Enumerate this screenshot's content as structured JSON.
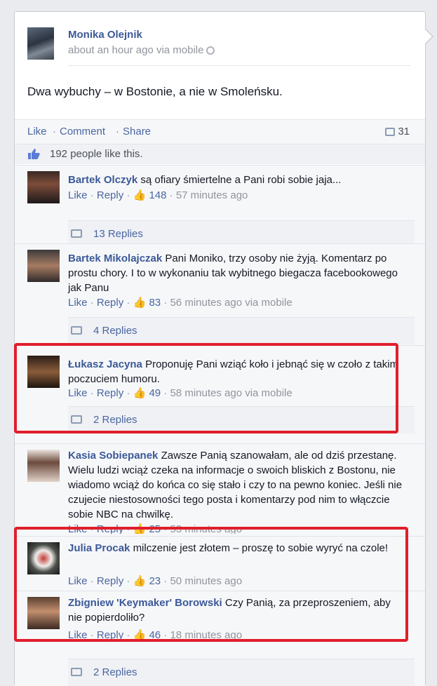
{
  "post": {
    "author": "Monika Olejnik",
    "meta": "about an hour ago via mobile",
    "status": "Dwa wybuchy – w Bostonie, a nie w Smoleńsku.",
    "actions": {
      "like": "Like",
      "comment": "Comment",
      "share": "Share",
      "sep": "·"
    },
    "comment_count": "31",
    "likes": "192 people like this."
  },
  "comments": [
    {
      "name": "Bartek Olczyk",
      "text": "są ofiary śmiertelne a Pani robi sobie jaja...",
      "like": "Like",
      "reply": "Reply",
      "likes": "148",
      "time": "57 minutes ago",
      "replies": "13 Replies"
    },
    {
      "name": "Bartek Mikolajczak",
      "text": "Pani Moniko, trzy osoby nie żyją. Komentarz po prostu chory. I to w wykonaniu tak wybitnego biegacza facebookowego jak Panu",
      "like": "Like",
      "reply": "Reply",
      "likes": "83",
      "time": "56 minutes ago via mobile",
      "replies": "4 Replies"
    },
    {
      "name": "Łukasz Jacyna",
      "text": "Proponuję Pani wziąć koło i jebnąć się w czoło z takim poczuciem humoru.",
      "like": "Like",
      "reply": "Reply",
      "likes": "49",
      "time": "58 minutes ago via mobile",
      "replies": "2 Replies"
    },
    {
      "name": "Kasia Sobiepanek",
      "text": "Zawsze Panią szanowałam, ale od dziś przestanę. Wielu ludzi wciąż czeka na informacje o swoich bliskich z Bostonu, nie wiadomo wciąż do końca co się stało i czy to na pewno koniec. Jeśli nie czujecie niestosowności tego posta i komentarzy pod nim to włączcie sobie NBC na chwilkę.",
      "like": "Like",
      "reply": "Reply",
      "likes": "25",
      "time": "53 minutes ago"
    },
    {
      "name": "Julia Procak",
      "text": "milczenie jest złotem – proszę to sobie wyryć na czole!",
      "like": "Like",
      "reply": "Reply",
      "likes": "23",
      "time": "50 minutes ago"
    },
    {
      "name": "Zbigniew 'Keymaker' Borowski",
      "text": "Czy Panią, za przeproszeniem, aby nie popierdoliło?",
      "like": "Like",
      "reply": "Reply",
      "likes": "46",
      "time": "18 minutes ago",
      "replies": "2 Replies"
    }
  ],
  "colors": {
    "link": "#3b5998",
    "highlight": "#e01e2b"
  }
}
